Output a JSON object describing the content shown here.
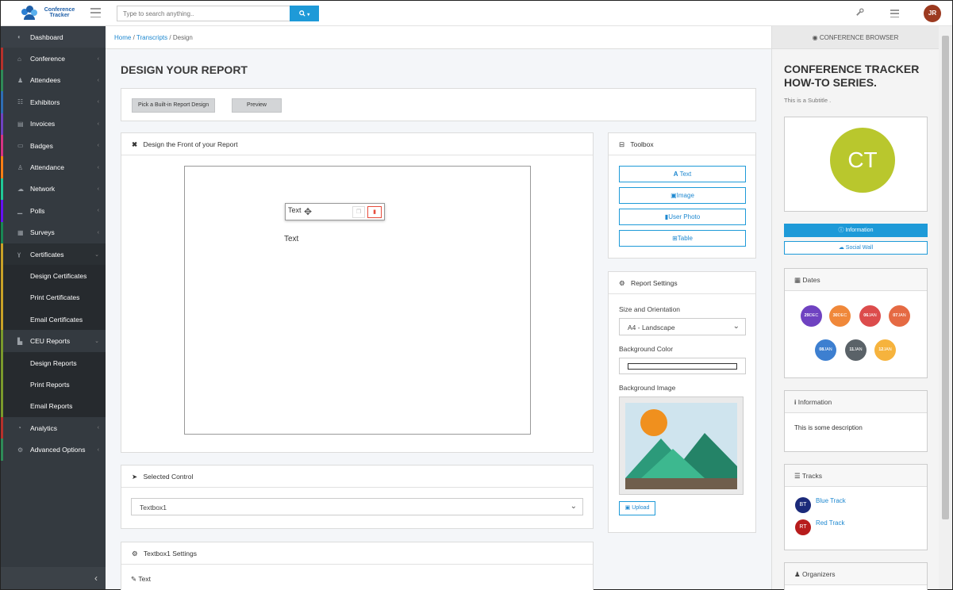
{
  "app": {
    "logo_line1": "Conference",
    "logo_line2": "Tracker"
  },
  "search": {
    "placeholder": "Type to search anything.."
  },
  "user": {
    "initials": "JR"
  },
  "sidebar": {
    "items": [
      {
        "label": "Dashboard",
        "icon": "dashboard-icon"
      },
      {
        "label": "Conference",
        "icon": "home-icon"
      },
      {
        "label": "Attendees",
        "icon": "user-icon"
      },
      {
        "label": "Exhibitors",
        "icon": "users-icon"
      },
      {
        "label": "Invoices",
        "icon": "file-icon"
      },
      {
        "label": "Badges",
        "icon": "id-card-icon"
      },
      {
        "label": "Attendance",
        "icon": "user-check-icon"
      },
      {
        "label": "Network",
        "icon": "comments-icon"
      },
      {
        "label": "Polls",
        "icon": "chart-icon"
      },
      {
        "label": "Surveys",
        "icon": "poll-icon"
      },
      {
        "label": "Certificates",
        "icon": "award-icon"
      },
      {
        "label": "Design Certificates"
      },
      {
        "label": "Print Certificates"
      },
      {
        "label": "Email Certificates"
      },
      {
        "label": "CEU Reports",
        "icon": "book-icon"
      },
      {
        "label": "Design Reports"
      },
      {
        "label": "Print Reports"
      },
      {
        "label": "Email Reports"
      },
      {
        "label": "Analytics",
        "icon": "chart-pie-icon"
      },
      {
        "label": "Advanced Options",
        "icon": "cogs-icon"
      }
    ],
    "collapse": "‹"
  },
  "breadcrumb": {
    "home": "Home",
    "sep": "/",
    "transcripts": "Transcripts",
    "current": "Design"
  },
  "page": {
    "title": "DESIGN YOUR REPORT"
  },
  "toolbar": {
    "builtin": "Pick a Built-in Report Design",
    "preview": "Preview"
  },
  "designer": {
    "header": "Design the Front of your Report",
    "control_text": "Text",
    "canvas_text": "Text"
  },
  "toolbox": {
    "header": "Toolbox",
    "items": [
      {
        "label": "Text",
        "icon": "A"
      },
      {
        "label": "Image",
        "icon": "▣"
      },
      {
        "label": "User Photo",
        "icon": "▮"
      },
      {
        "label": "Table",
        "icon": "⊞"
      }
    ]
  },
  "report_settings": {
    "header": "Report Settings",
    "size_label": "Size and Orientation",
    "size_value": "A4 - Landscape",
    "bg_color_label": "Background Color",
    "bg_image_label": "Background Image",
    "upload": "Upload"
  },
  "selected_control": {
    "header": "Selected Control",
    "value": "Textbox1"
  },
  "textbox_settings": {
    "header": "Textbox1 Settings",
    "field": "Text"
  },
  "browser": {
    "header": "CONFERENCE BROWSER",
    "title": "CONFERENCE TRACKER HOW-TO SERIES.",
    "subtitle": "This is a Subtitle .",
    "logo_initials": "CT",
    "info_button": "Information",
    "wall_button": "Social Wall",
    "dates_header": "Dates",
    "dates": [
      {
        "day": "29",
        "mon": "DEC",
        "color": "#6f42c1"
      },
      {
        "day": "30",
        "mon": "DEC",
        "color": "#f0883a"
      },
      {
        "day": "06",
        "mon": "JAN",
        "color": "#dc4c4c"
      },
      {
        "day": "07",
        "mon": "JAN",
        "color": "#e56a43"
      },
      {
        "day": "08",
        "mon": "JAN",
        "color": "#3d7fd0"
      },
      {
        "day": "11",
        "mon": "JAN",
        "color": "#5a6268"
      },
      {
        "day": "12",
        "mon": "JAN",
        "color": "#f6b33d"
      }
    ],
    "information_header": "Information",
    "information_text": "This is some description",
    "tracks_header": "Tracks",
    "tracks": [
      {
        "badge": "BT",
        "name": "Blue Track",
        "color": "#1b2a7a"
      },
      {
        "badge": "RT",
        "name": "Red Track",
        "color": "#b71c1c"
      }
    ],
    "organizers_header": "Organizers"
  }
}
